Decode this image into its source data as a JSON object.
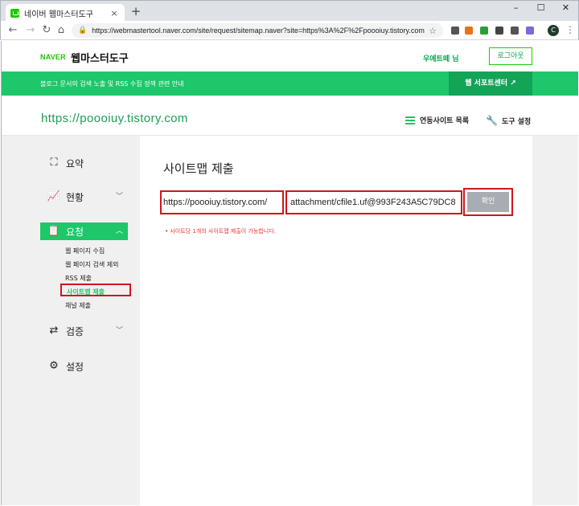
{
  "browser": {
    "tab_title": "네이버 웹마스터도구",
    "tab_close": "×",
    "new_tab": "+",
    "window_controls": [
      "–",
      "☐",
      "✕"
    ],
    "url": "https://webmastertool.naver.com/site/request/sitemap.naver?site=https%3A%2F%2Fpoooiuy.tistory.com",
    "lock_icon": "🔒",
    "star_icon": "☆",
    "profile_letter": "C",
    "menu_icon": "⋮",
    "extensions": [
      {
        "name": "bookmark-ext-icon",
        "color": "#555555"
      },
      {
        "name": "rx-ext-icon",
        "color": "#e8711c"
      },
      {
        "name": "screen-ext-icon",
        "color": "#2e9c3a"
      },
      {
        "name": "dark-ext-icon",
        "color": "#444444"
      },
      {
        "name": "s-ext-icon",
        "color": "#555555"
      },
      {
        "name": "shield-ext-icon",
        "color": "#7b6bd6"
      }
    ]
  },
  "header": {
    "logo_naver": "NAVER",
    "logo_title": "웹마스터도구",
    "user_name": "우에트떼 님",
    "logout_label": "로그아웃"
  },
  "green_bar": {
    "notice": "블로그 문서의 검색 노출 및 RSS 수집 정책 관련 안내",
    "support_label": "웹 서포트센터 ↗"
  },
  "site": {
    "url": "https://poooiuy.tistory.com",
    "linked_sites_label": "연동사이트 목록",
    "tool_settings_label": "도구 설정"
  },
  "sidebar": {
    "summary_label": "요약",
    "status_label": "현황",
    "request_label": "요청",
    "request_sub": [
      "웹 페이지 수집",
      "웹 페이지 검색 제외",
      "RSS 제출",
      "사이트맵 제출",
      "채널 제출"
    ],
    "verify_label": "검증",
    "settings_label": "설정"
  },
  "main": {
    "title": "사이트맵 제출",
    "url_prefix": "https://poooiuy.tistory.com/",
    "input_value": "attachment/cfile1.uf@993F243A5C79DC8",
    "confirm_label": "확인",
    "hint": "• 사이트당 1개의 사이트맵 제출이 가능합니다."
  },
  "colors": {
    "brand_green": "#1ec76a",
    "dark_green": "#13a457",
    "highlight_red": "#d0161b"
  }
}
